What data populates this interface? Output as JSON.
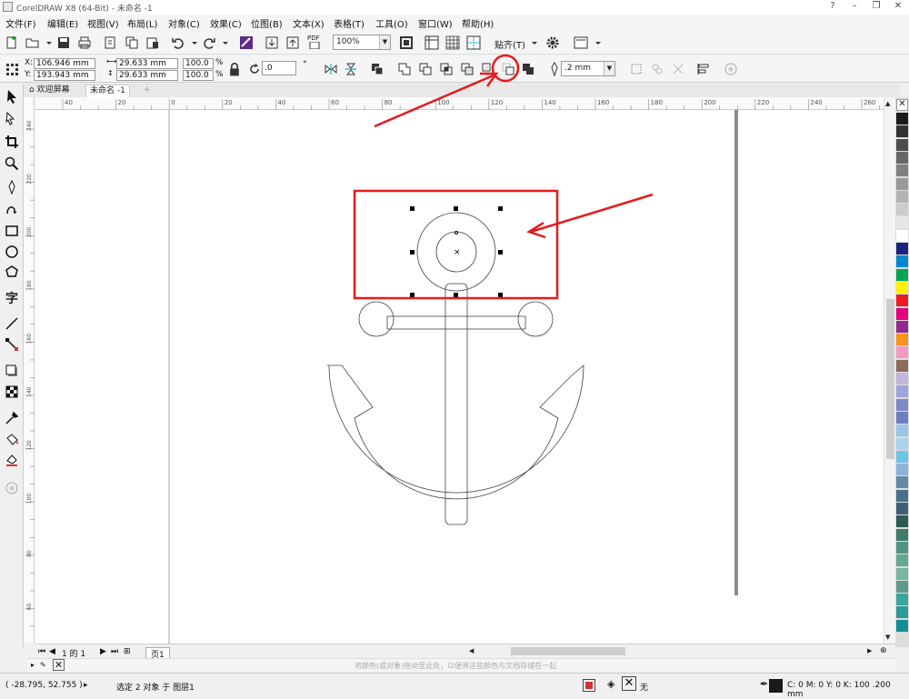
{
  "window": {
    "title": "CorelDRAW X8 (64-Bit) - 未命名 -1",
    "controls": [
      "?",
      "–",
      "❐",
      "✕"
    ]
  },
  "menu": [
    "文件(F)",
    "编辑(E)",
    "视图(V)",
    "布局(L)",
    "对象(C)",
    "效果(C)",
    "位图(B)",
    "文本(X)",
    "表格(T)",
    "工具(O)",
    "窗口(W)",
    "帮助(H)"
  ],
  "toolbar": {
    "zoom": "100%",
    "snap_label": "贴齐(T)",
    "pdf_label": "PDF"
  },
  "property_bar": {
    "x_label": "X:",
    "x_value": "106.946 mm",
    "y_label": "Y:",
    "y_value": "193.943 mm",
    "w_value": "29.633 mm",
    "h_value": "29.633 mm",
    "scale_w": "100.0",
    "scale_h": "100.0",
    "percent": "%",
    "rotation": ".0",
    "rotation_unit": "°",
    "outline_width": ".2 mm"
  },
  "tabs": {
    "welcome": "欢迎屏幕",
    "document": "未命名 -1"
  },
  "ruler": {
    "h_ticks": [
      "40",
      "20",
      "0",
      "20",
      "40",
      "60",
      "80",
      "100",
      "120",
      "140",
      "160",
      "180",
      "200",
      "220",
      "240",
      "260"
    ],
    "v_ticks": [
      "240",
      "220",
      "200",
      "180",
      "160",
      "140",
      "120",
      "100",
      "80",
      "60",
      "40"
    ],
    "unit": "毫米"
  },
  "page_nav": {
    "page_count": "1 的 1",
    "page_tab": "页1"
  },
  "color_hint": "将颜色(或对象)拖动至此处，以便将这些颜色与文档存储在一起",
  "status": {
    "coords": "( -28.795, 52.755 )",
    "selection": "选定 2 对象 于 图层1",
    "fill_none": "无",
    "outline_info": "C: 0 M: 0 Y: 0 K: 100  .200 mm"
  },
  "colors": {
    "accent_red": "#e8191b",
    "palette": [
      "#1a1a1a",
      "#333333",
      "#4d4d4d",
      "#666666",
      "#808080",
      "#999999",
      "#b3b3b3",
      "#cccccc",
      "#e6e6e6",
      "#ffffff",
      "#1a237e",
      "#0288d1",
      "#00a651",
      "#fff200",
      "#ed1c24",
      "#e4007f",
      "#92278f",
      "#f7941d",
      "#f49ac1",
      "#8b6d5c",
      "#c2b5de",
      "#9ea6d8",
      "#7f88c8",
      "#6d7ebd",
      "#9bc5e8",
      "#a9d5ec",
      "#6cc4e6",
      "#8db4d9",
      "#628aa7",
      "#496f8c",
      "#3b5f73",
      "#2d5a55",
      "#3f7a6b",
      "#4f9383",
      "#62a893",
      "#74b89f",
      "#5d9b8c",
      "#3ca59b",
      "#2a9c96",
      "#138f96"
    ]
  }
}
